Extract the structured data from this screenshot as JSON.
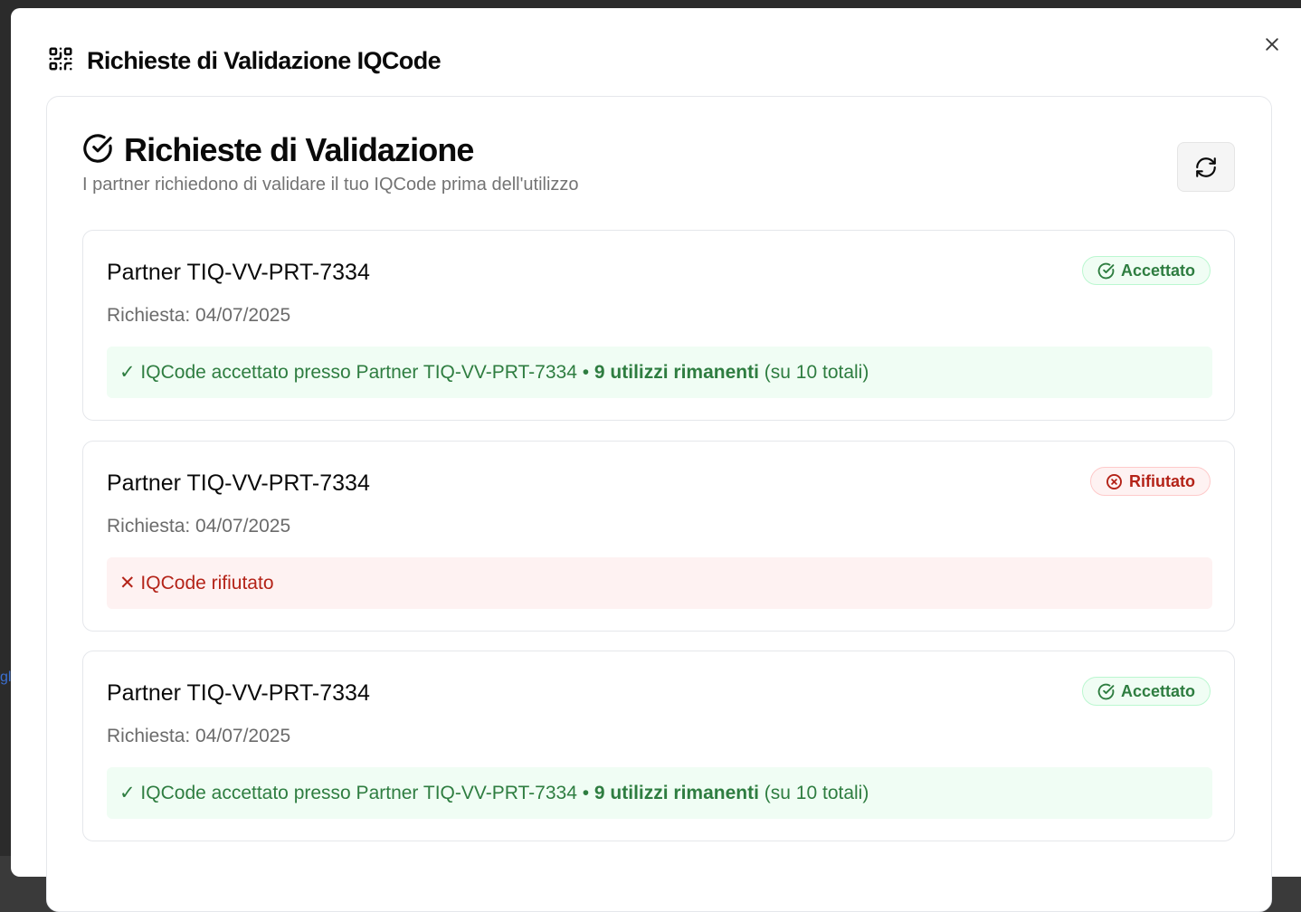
{
  "modal": {
    "title": "Richieste di Validazione IQCode",
    "close_icon": "close-icon",
    "qr_icon": "qr-code-icon"
  },
  "backdrop": {
    "stub_text": "gl"
  },
  "card": {
    "title": "Richieste di Validazione",
    "subtitle": "I partner richiedono di validare il tuo IQCode prima dell'utilizzo",
    "refresh_icon": "refresh-icon"
  },
  "requests": [
    {
      "partner": "Partner TIQ-VV-PRT-7334",
      "date": "Richiesta: 04/07/2025",
      "status": "Accettato",
      "status_kind": "accepted",
      "message": "✓ IQCode accettato presso Partner TIQ-VV-PRT-7334",
      "separator": " • ",
      "remaining": "9 utilizzi rimanenti",
      "total": " (su 10 totali)"
    },
    {
      "partner": "Partner TIQ-VV-PRT-7334",
      "date": "Richiesta: 04/07/2025",
      "status": "Rifiutato",
      "status_kind": "rejected",
      "message": "✕ IQCode rifiutato"
    },
    {
      "partner": "Partner TIQ-VV-PRT-7334",
      "date": "Richiesta: 04/07/2025",
      "status": "Accettato",
      "status_kind": "accepted",
      "message": "✓ IQCode accettato presso Partner TIQ-VV-PRT-7334",
      "separator": " • ",
      "remaining": "9 utilizzi rimanenti",
      "total": " (su 10 totali)"
    }
  ],
  "colors": {
    "accepted": "#2e7d40",
    "rejected": "#b42318",
    "accepted_bg": "#f0fdf4",
    "rejected_bg": "#fef2f2"
  }
}
